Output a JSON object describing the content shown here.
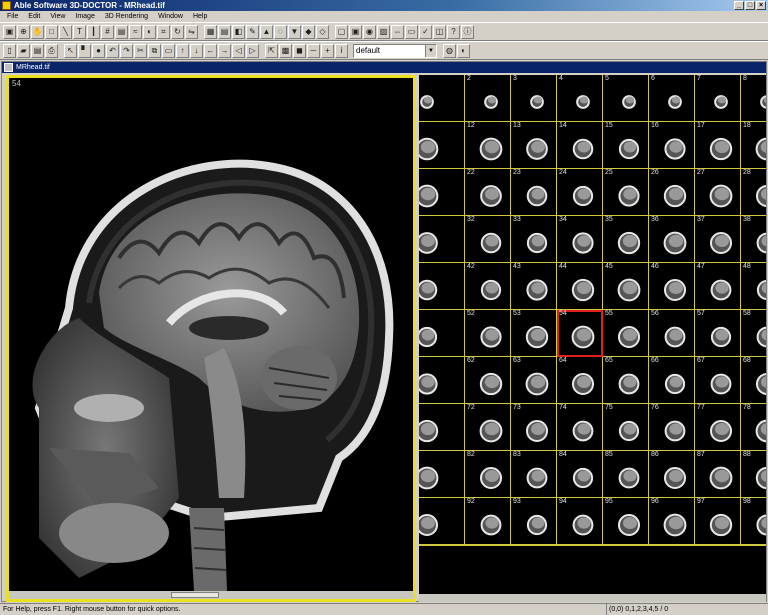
{
  "window": {
    "title": "Able Software 3D-DOCTOR - MRhead.tif"
  },
  "menu": [
    "File",
    "Edit",
    "View",
    "Image",
    "3D Rendering",
    "Window",
    "Help"
  ],
  "toolbar1_icons": [
    "select-icon",
    "zoom-icon",
    "pan-icon",
    "rect-icon",
    "line-icon",
    "text-icon",
    "ruler-icon",
    "grid-icon",
    "histogram-icon",
    "filter-icon",
    "contrast-icon",
    "crop-icon",
    "rotate-icon",
    "flip-icon",
    "montage-icon",
    "stack-icon",
    "slice-icon",
    "pen-icon",
    "paint-icon",
    "eraser-icon",
    "fill-icon",
    "threshold-icon",
    "boundary-icon",
    "region-icon",
    "render-icon",
    "surface-icon",
    "volume-icon",
    "measure-icon",
    "area-icon",
    "calib-icon",
    "overlay-icon",
    "help-icon",
    "about-icon"
  ],
  "toolbar2_icons": [
    "new-icon",
    "open-icon",
    "save-icon",
    "print-icon",
    "pointer-icon",
    "brush-icon",
    "color-icon",
    "undo-icon",
    "redo-icon",
    "cut-icon",
    "copy-icon",
    "paste-icon",
    "up-icon",
    "down-icon",
    "left-icon",
    "right-icon",
    "prev-icon",
    "next-icon",
    "cursor-icon",
    "image-icon",
    "segment-icon",
    "line-tool-icon",
    "plus-icon",
    "info-icon"
  ],
  "toolbar2_toggle_icons": [
    "ct-icon",
    "mri-icon"
  ],
  "preset": {
    "value": "default"
  },
  "document": {
    "title": "MRhead.tif"
  },
  "main_view": {
    "slice_label": "54"
  },
  "thumbnails": {
    "visible_labels": [
      "2",
      "3",
      "4",
      "5",
      "6",
      "7",
      "8",
      "12",
      "13",
      "14",
      "15",
      "16",
      "17",
      "18",
      "22",
      "23",
      "24",
      "25",
      "26",
      "27",
      "28",
      "32",
      "33",
      "34",
      "35",
      "36",
      "37",
      "38",
      "42",
      "43",
      "44",
      "45",
      "46",
      "47",
      "48",
      "52",
      "53",
      "54",
      "55",
      "56",
      "57",
      "58",
      "62",
      "63",
      "64",
      "65",
      "66",
      "67",
      "68",
      "72",
      "73",
      "74",
      "75",
      "76",
      "77",
      "78",
      "82",
      "83",
      "84",
      "85",
      "86",
      "87",
      "88",
      "92",
      "93",
      "94",
      "95",
      "96",
      "97",
      "98",
      "102",
      "103",
      "104",
      "105",
      "106",
      "107",
      "108"
    ],
    "numbers_shown": [
      [
        "2",
        "3",
        "4",
        "5",
        "6",
        "7",
        "8"
      ],
      [
        "12",
        "13",
        "14",
        "15",
        "16",
        "17",
        "18"
      ],
      [
        "22",
        "23",
        "24",
        "25",
        "26",
        "27",
        "28"
      ],
      [
        "32",
        "33",
        "34",
        "35",
        "36",
        "37",
        "38"
      ],
      [
        "42",
        "43",
        "44",
        "45",
        "46",
        "47",
        "48"
      ],
      [
        "52",
        "53",
        "54",
        "55",
        "56",
        "57",
        "58"
      ],
      [
        "62",
        "63",
        "64",
        "65",
        "66",
        "67",
        "68"
      ],
      [
        "72",
        "73",
        "74",
        "75",
        "76",
        "77",
        "78"
      ],
      [
        "82",
        "83",
        "84",
        "85",
        "86",
        "87",
        "88"
      ],
      [
        "92",
        "93",
        "94",
        "95",
        "96",
        "97",
        "98"
      ],
      [
        "102",
        "103",
        "104",
        "105",
        "106",
        "107",
        "108"
      ]
    ],
    "selected": "54"
  },
  "status": {
    "left": "For Help, press F1. Right mouse button for quick options.",
    "right": "(0,0) 0,1,2,3,4,5 / 0"
  },
  "colors": {
    "grid_line": "#d0c840",
    "selection": "#e02020",
    "title_bar": "#0a246a"
  }
}
